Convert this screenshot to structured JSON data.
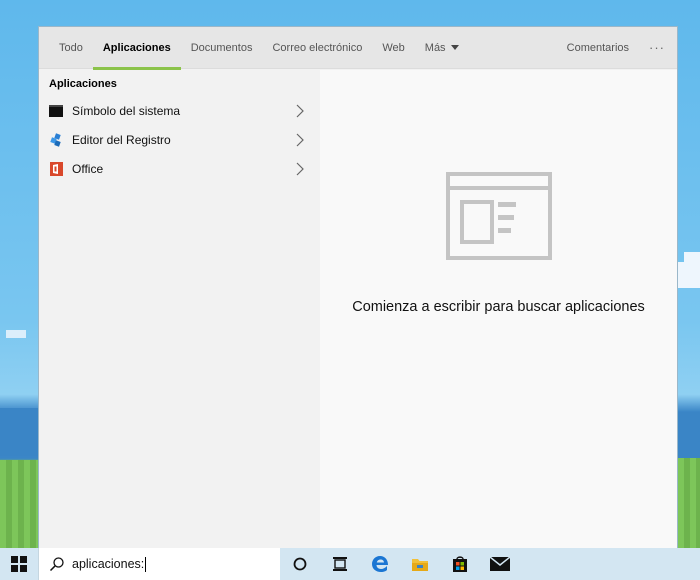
{
  "tabs": [
    {
      "label": "Todo"
    },
    {
      "label": "Aplicaciones",
      "active": true
    },
    {
      "label": "Documentos"
    },
    {
      "label": "Correo electrónico"
    },
    {
      "label": "Web"
    },
    {
      "label": "Más"
    }
  ],
  "header": {
    "feedback_label": "Comentarios",
    "more_options": "···"
  },
  "results": {
    "section_title": "Aplicaciones",
    "items": [
      {
        "label": "Símbolo del sistema",
        "icon": "command-prompt-icon"
      },
      {
        "label": "Editor del Registro",
        "icon": "registry-editor-icon"
      },
      {
        "label": "Office",
        "icon": "office-icon"
      }
    ]
  },
  "preview": {
    "icon": "app-window-icon",
    "hint": "Comienza a escribir para buscar aplicaciones"
  },
  "taskbar": {
    "search_value": "aplicaciones: ",
    "icons": [
      "windows-start-icon",
      "search-icon",
      "cortana-icon",
      "task-view-icon",
      "edge-icon",
      "file-explorer-icon",
      "store-icon",
      "mail-icon"
    ]
  },
  "colors": {
    "accent": "#8bc34a",
    "taskbar": "#d3e6f2",
    "panel": "#f2f2f2"
  }
}
